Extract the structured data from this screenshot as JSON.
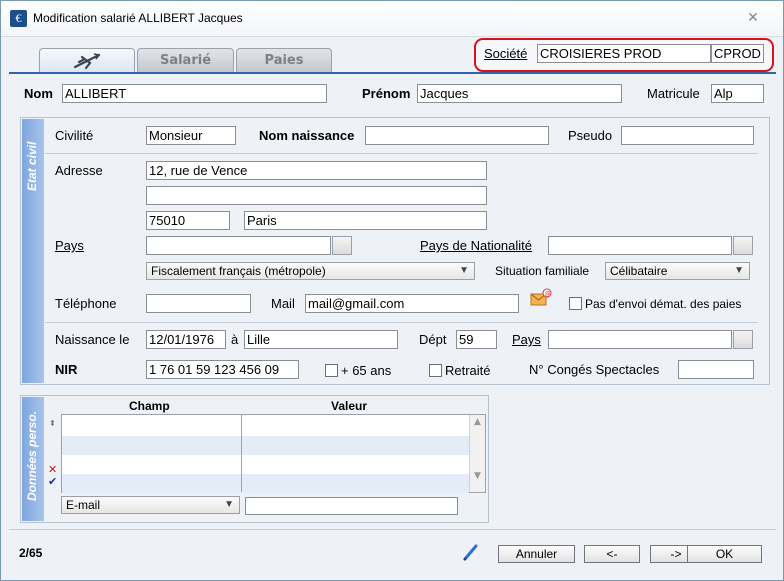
{
  "window": {
    "title": "Modification salarié ALLIBERT Jacques",
    "app_icon": "€",
    "close_icon": "✕"
  },
  "tabs": [
    {
      "label": "",
      "icon": "plane-icon"
    },
    {
      "label": "Salarié"
    },
    {
      "label": "Paies"
    }
  ],
  "societe": {
    "label": "Société",
    "name": "CROISIERES PROD",
    "code": "CPROD"
  },
  "header": {
    "nom_label": "Nom",
    "nom_value": "ALLIBERT",
    "prenom_label": "Prénom",
    "prenom_value": "Jacques",
    "matricule_label": "Matricule",
    "matricule_value": "Alp"
  },
  "etat_civil": {
    "section_title": "Etat civil",
    "civilite_label": "Civilité",
    "civilite_value": "Monsieur",
    "nom_naissance_label": "Nom naissance",
    "nom_naissance_value": "",
    "pseudo_label": "Pseudo",
    "pseudo_value": "",
    "adresse_label": "Adresse",
    "adresse1": "12, rue de Vence",
    "adresse2": "",
    "cp": "75010",
    "ville": "Paris",
    "pays_label": "Pays",
    "pays_value": "",
    "pays_nat_label": "Pays de Nationalité",
    "pays_nat_value": "",
    "fiscal_value": "Fiscalement français (métropole)",
    "situation_label": "Situation familiale",
    "situation_value": "Célibataire",
    "telephone_label": "Téléphone",
    "telephone_value": "",
    "mail_label": "Mail",
    "mail_value": "mail@gmail.com",
    "pas_envoi_label": "Pas d'envoi démat. des paies",
    "naissance_label": "Naissance le",
    "naissance_value": "12/01/1976",
    "a_label": "à",
    "lieu_value": "Lille",
    "dept_label": "Dépt",
    "dept_value": "59",
    "pays2_label": "Pays",
    "pays2_value": "",
    "nir_label": "NIR",
    "nir_value": "1 76 01 59 123 456 09",
    "plus65_label": "+ 65 ans",
    "retraite_label": "Retraité",
    "conges_label": "N° Congés Spectacles",
    "conges_value": ""
  },
  "donnees": {
    "section_title": "Données perso.",
    "col_champ": "Champ",
    "col_valeur": "Valeur",
    "type_value": "E-mail",
    "valeur_value": ""
  },
  "footer": {
    "counter": "2/65",
    "annuler": "Annuler",
    "prev": "<-",
    "next": "->",
    "ok": "OK"
  },
  "colors": {
    "tab_line": "#2e65a8",
    "highlight": "#d8101a",
    "side_tab": "#8fb2e4"
  }
}
